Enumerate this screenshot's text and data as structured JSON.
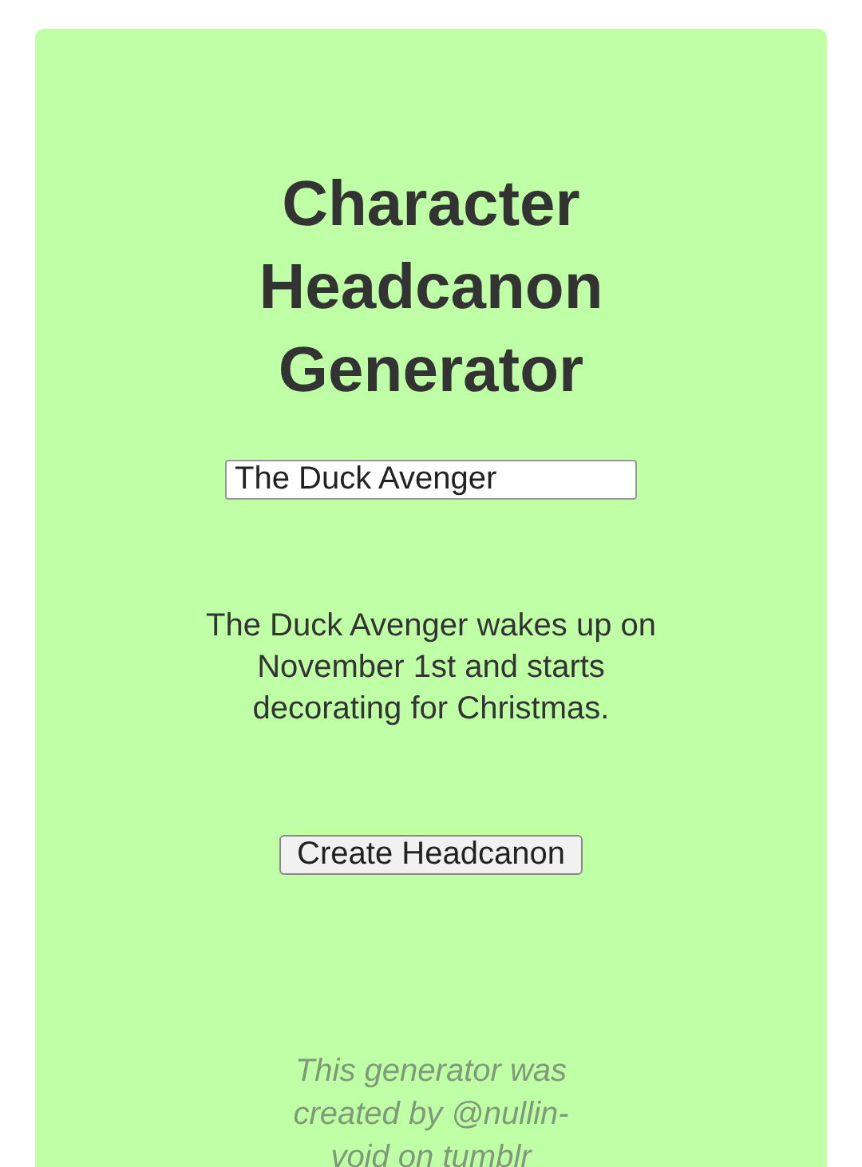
{
  "title": "Character Headcanon Generator",
  "name_field": {
    "value": "The Duck Avenger"
  },
  "headcanon": "The Duck Avenger wakes up on November 1st and starts decorating for Christmas.",
  "button": "Create Headcanon",
  "footer": "This generator was created by @nullin-void on tumblr"
}
